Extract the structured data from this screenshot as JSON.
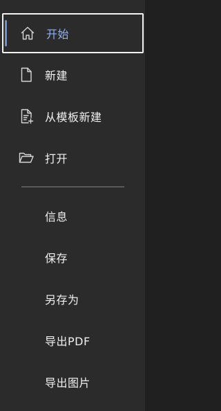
{
  "nav": {
    "items": [
      {
        "label": "开始",
        "icon": "home-icon"
      },
      {
        "label": "新建",
        "icon": "new-document-icon"
      },
      {
        "label": "从模板新建",
        "icon": "new-from-template-icon"
      },
      {
        "label": "打开",
        "icon": "open-folder-icon"
      }
    ],
    "sub_items": [
      {
        "label": "信息"
      },
      {
        "label": "保存"
      },
      {
        "label": "另存为"
      },
      {
        "label": "导出PDF"
      },
      {
        "label": "导出图片"
      }
    ]
  },
  "colors": {
    "panel_bg": "#2b2b2b",
    "backdrop": "#202020",
    "active_text": "#8fb0f5",
    "active_indicator": "#6e8fd6",
    "text": "#f0f0f0"
  }
}
